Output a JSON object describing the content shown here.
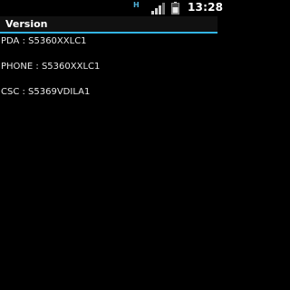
{
  "status_bar": {
    "time": "13:28",
    "network_type": "H",
    "icons": [
      "network-type-icon",
      "signal-icon",
      "battery-icon"
    ],
    "accent": "#4fb0d8"
  },
  "header": {
    "title": "Version",
    "accent": "#33b5e5"
  },
  "versions": [
    {
      "label": "PDA",
      "value": "S5360XXLC1",
      "text": "PDA : S5360XXLC1"
    },
    {
      "label": "PHONE",
      "value": "S5360XXLC1",
      "text": "PHONE : S5360XXLC1"
    },
    {
      "label": "CSC",
      "value": "S5369VDILA1",
      "text": "CSC : S5369VDILA1"
    }
  ]
}
